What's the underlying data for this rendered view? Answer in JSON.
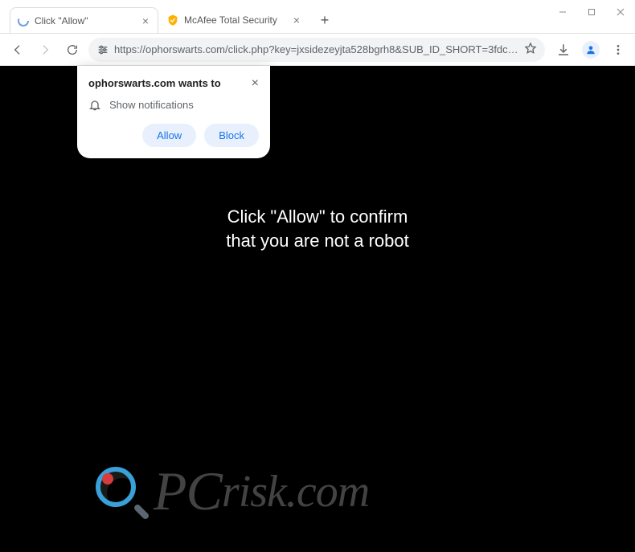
{
  "tabs": [
    {
      "title": "Click &quot;Allow&quot;",
      "favicon": "loading"
    },
    {
      "title": "McAfee Total Security",
      "favicon": "mcafee"
    }
  ],
  "url": "https://ophorswarts.com/click.php?key=jxsidezeyjta528bgrh8&SUB_ID_SHORT=3fdc110aac6af4cc79b99b9899923...",
  "permission": {
    "title": "ophorswarts.com wants to",
    "item": "Show notifications",
    "allow_label": "Allow",
    "block_label": "Block"
  },
  "page_text": {
    "line1": "Click \"Allow\" to confirm",
    "line2": "that you are not a robot"
  },
  "watermark": {
    "p": "P",
    "c": "C",
    "rest": "risk.com"
  }
}
